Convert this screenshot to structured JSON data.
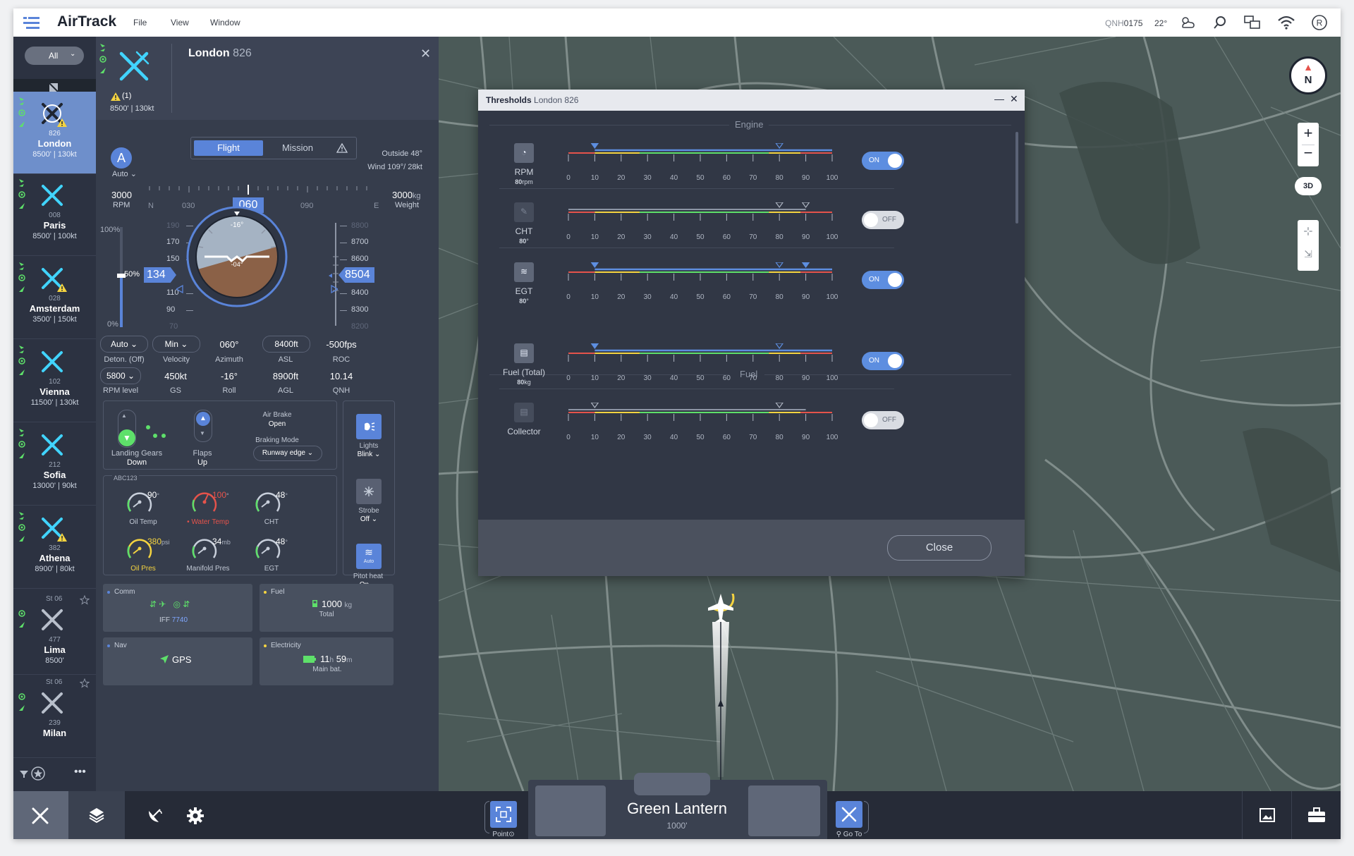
{
  "app": {
    "title": "AirTrack",
    "menu": [
      "File",
      "View",
      "Window"
    ]
  },
  "status": {
    "qnh_label": "QNH",
    "qnh_value": "0175",
    "temp": "22°"
  },
  "filter": {
    "value": "All"
  },
  "aircraft": [
    {
      "code": "826",
      "name": "London",
      "alt": "8500'",
      "speed": "130kt",
      "warn": true,
      "selected": true
    },
    {
      "code": "008",
      "name": "Paris",
      "alt": "8500'",
      "speed": "100kt"
    },
    {
      "code": "028",
      "name": "Amsterdam",
      "alt": "3500'",
      "speed": "150kt",
      "warn": true
    },
    {
      "code": "102",
      "name": "Vienna",
      "alt": "11500'",
      "speed": "130kt"
    },
    {
      "code": "212",
      "name": "Sofia",
      "alt": "13000'",
      "speed": "90kt"
    },
    {
      "code": "382",
      "name": "Athena",
      "alt": "8900'",
      "speed": "80kt",
      "warn": true
    },
    {
      "code": "477",
      "name": "Lima",
      "alt": "8500'",
      "status": "St 06"
    },
    {
      "code": "239",
      "name": "Milan",
      "alt": "",
      "status": "St 06"
    }
  ],
  "panel": {
    "title": "London",
    "id": "826",
    "warning_count": "(1)",
    "alt_speed": "8500' | 130kt",
    "tabs": {
      "flight": "Flight",
      "mission": "Mission"
    },
    "mode_letter": "A",
    "mode_label": "Auto",
    "outside": "Outside 48°",
    "wind": "Wind 109°/ 28kt",
    "rpm": {
      "value": "3000",
      "label": "RPM"
    },
    "weight": {
      "value": "3000",
      "unit": "kg",
      "label": "Weight"
    },
    "heading": {
      "value": "060",
      "ticks": [
        "N",
        "030",
        "060",
        "090",
        "E"
      ]
    },
    "throttle": {
      "top": "100%",
      "mid": "50%",
      "bottom": "0%"
    },
    "speed_tape": {
      "value": "134",
      "ticks": [
        "190",
        "170",
        "150",
        "110",
        "90",
        "70"
      ]
    },
    "alt_tape": {
      "value": "8504",
      "ticks": [
        "8800",
        "8700",
        "8600",
        "8400",
        "8300",
        "8200"
      ]
    },
    "attitude": {
      "bank": "-16°",
      "pitch": "-04°"
    },
    "row1": [
      {
        "value": "Auto",
        "label": "Deton. (Off)",
        "dropdown": true
      },
      {
        "value": "Min",
        "label": "Velocity",
        "dropdown": true
      },
      {
        "value": "060°",
        "label": "Azimuth"
      },
      {
        "value": "8400ft",
        "label": "ASL"
      },
      {
        "value": "-500fps",
        "label": "ROC"
      }
    ],
    "row2": [
      {
        "value": "5800",
        "label": "RPM level",
        "dropdown": true
      },
      {
        "value": "450kt",
        "label": "GS"
      },
      {
        "value": "-16°",
        "label": "Roll"
      },
      {
        "value": "8900ft",
        "label": "AGL"
      },
      {
        "value": "10.14",
        "label": "QNH"
      }
    ],
    "landing_gears": {
      "label": "Landing Gears",
      "value": "Down"
    },
    "flaps": {
      "label": "Flaps",
      "value": "Up"
    },
    "air_brake": {
      "label": "Air Brake",
      "value": "Open"
    },
    "braking_mode": {
      "label": "Braking Mode",
      "value": "Runway edge"
    },
    "engine_group": "ABC123",
    "gauges": [
      {
        "label": "Oil Temp",
        "value": "90",
        "unit": "°"
      },
      {
        "label": "Water Temp",
        "value": "100",
        "unit": "°",
        "alert": true
      },
      {
        "label": "CHT",
        "value": "48",
        "unit": "°"
      },
      {
        "label": "Oil Pres",
        "value": "380",
        "unit": "psi",
        "warn": true
      },
      {
        "label": "Manifold Pres",
        "value": "34",
        "unit": "mb"
      },
      {
        "label": "EGT",
        "value": "48",
        "unit": "°"
      }
    ],
    "lights": {
      "label": "Lights",
      "value": "Blink"
    },
    "strobe": {
      "label": "Strobe",
      "value": "Off"
    },
    "pitot": {
      "label": "Pitot heat",
      "value": "On",
      "badge": "Auto"
    },
    "comm": {
      "header": "Comm",
      "iff_label": "IFF",
      "iff_value": "7740"
    },
    "fuel": {
      "header": "Fuel",
      "value": "1000",
      "unit": "kg",
      "label": "Total"
    },
    "nav": {
      "header": "Nav",
      "value": "GPS"
    },
    "electricity": {
      "header": "Electricity",
      "hours": "11",
      "minutes": "59",
      "label": "Main bat."
    }
  },
  "thresholds": {
    "title": "Thresholds",
    "aircraft": "London 826",
    "section_engine": "Engine",
    "section_fuel": "Fuel",
    "scale_ticks": [
      "0",
      "10",
      "20",
      "30",
      "40",
      "50",
      "60",
      "70",
      "80",
      "90",
      "100"
    ],
    "rows": [
      {
        "name": "RPM",
        "value": "80",
        "unit": "rpm",
        "toggle": "ON"
      },
      {
        "name": "CHT",
        "value": "80",
        "unit": "°",
        "toggle": "OFF"
      },
      {
        "name": "EGT",
        "value": "80",
        "unit": "°",
        "toggle": "ON"
      },
      {
        "name": "Fuel (Total)",
        "value": "80",
        "unit": "kg",
        "toggle": "ON"
      },
      {
        "name": "Collector",
        "value": "",
        "unit": "",
        "toggle": "OFF"
      }
    ],
    "close": "Close"
  },
  "map": {
    "compass": "N",
    "mode_3d": "3D"
  },
  "bottom": {
    "point_label": "Point",
    "goto_label": "Go To",
    "callsign": "Green Lantern",
    "altitude": "1000'"
  },
  "colors": {
    "accent": "#5a84d9",
    "selected": "#6e8fcb",
    "icon": "#41d4ff",
    "warning": "#f5d440",
    "alert": "#e5534b"
  }
}
